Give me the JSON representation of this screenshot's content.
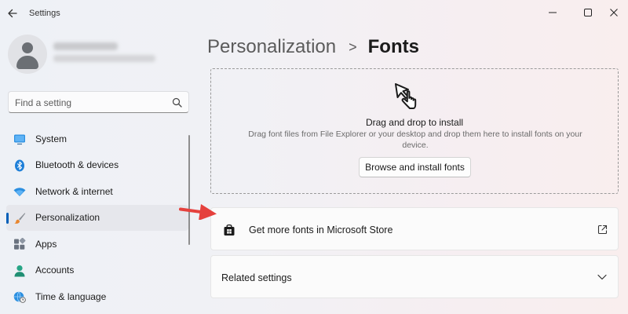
{
  "window": {
    "title": "Settings"
  },
  "search": {
    "placeholder": "Find a setting"
  },
  "sidebar": {
    "items": [
      {
        "label": "System",
        "icon": "monitor-icon"
      },
      {
        "label": "Bluetooth & devices",
        "icon": "bluetooth-icon"
      },
      {
        "label": "Network & internet",
        "icon": "wifi-icon"
      },
      {
        "label": "Personalization",
        "icon": "paintbrush-icon",
        "selected": true
      },
      {
        "label": "Apps",
        "icon": "apps-icon"
      },
      {
        "label": "Accounts",
        "icon": "accounts-icon"
      },
      {
        "label": "Time & language",
        "icon": "globe-clock-icon"
      }
    ]
  },
  "breadcrumb": {
    "parent": "Personalization",
    "separator": ">",
    "current": "Fonts"
  },
  "dropzone": {
    "title": "Drag and drop to install",
    "description": "Drag font files from File Explorer or your desktop and drop them here to install fonts on your device.",
    "button_label": "Browse and install fonts"
  },
  "store_link": {
    "label": "Get more fonts in Microsoft Store"
  },
  "related": {
    "label": "Related settings"
  },
  "colors": {
    "accent": "#005fb8",
    "annotation_arrow": "#e5413d"
  }
}
